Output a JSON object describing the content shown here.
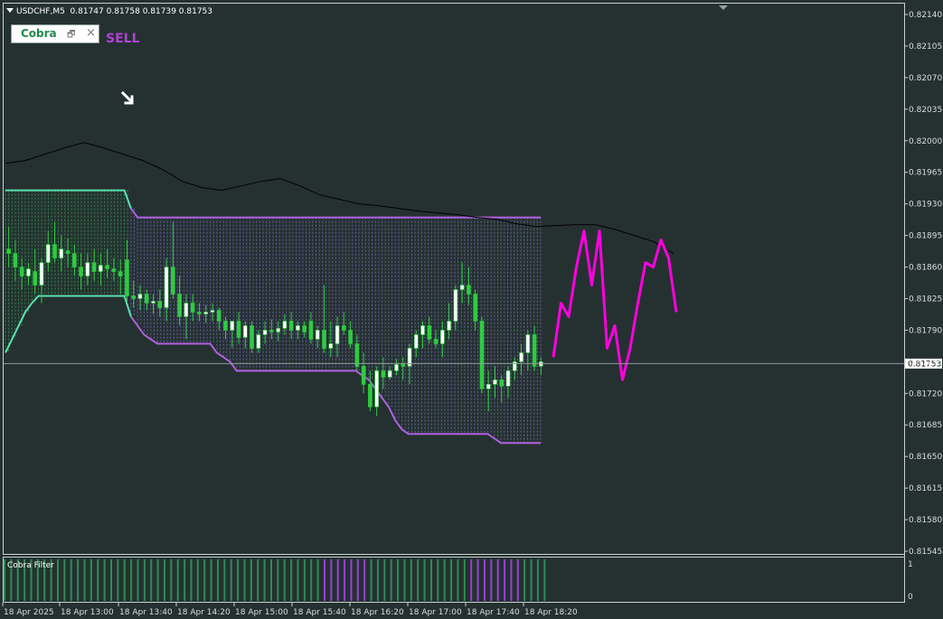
{
  "header": {
    "symbol": "USDCHF,M5",
    "ohlc": "0.81747 0.81758 0.81739 0.81753"
  },
  "indicator_box": {
    "name": "Cobra",
    "partial": "!",
    "close_glyph": "×"
  },
  "signal": {
    "text": "SELL",
    "color": "#b340d8"
  },
  "current_price": "0.81753",
  "subwindow": {
    "label": "Cobra Filter",
    "levels": [
      "1",
      "0"
    ]
  },
  "colors": {
    "background": "#253130",
    "bull_candle": "#ffffff",
    "bear_candle": "#2ecc40",
    "upper_band_green": "#5ae0b0",
    "band_purple": "#b060e0",
    "forecast": "#ff00e0",
    "filter_green": "#2e8b57",
    "filter_purple": "#9b40d8"
  },
  "chart_data": {
    "type": "candlestick",
    "title": "USDCHF,M5",
    "y_tick_labels": [
      "0.82140",
      "0.82105",
      "0.82070",
      "0.82035",
      "0.82000",
      "0.81965",
      "0.81930",
      "0.81895",
      "0.81860",
      "0.81825",
      "0.81790",
      "0.81755",
      "0.81720",
      "0.81685",
      "0.81650",
      "0.81615",
      "0.81580",
      "0.81545"
    ],
    "x_tick_labels": [
      "18 Apr 2025",
      "18 Apr 13:00",
      "18 Apr 13:40",
      "18 Apr 14:20",
      "18 Apr 15:00",
      "18 Apr 15:40",
      "18 Apr 16:20",
      "18 Apr 17:00",
      "18 Apr 17:40",
      "18 Apr 18:20"
    ],
    "ylim": [
      0.8154,
      0.82145
    ],
    "candles": [
      {
        "o": 0.8188,
        "h": 0.81905,
        "l": 0.8186,
        "c": 0.81875
      },
      {
        "o": 0.81875,
        "h": 0.8189,
        "l": 0.81845,
        "c": 0.8186
      },
      {
        "o": 0.8186,
        "h": 0.8187,
        "l": 0.81835,
        "c": 0.8185
      },
      {
        "o": 0.8185,
        "h": 0.81865,
        "l": 0.8184,
        "c": 0.81858
      },
      {
        "o": 0.81855,
        "h": 0.8188,
        "l": 0.8183,
        "c": 0.8184
      },
      {
        "o": 0.8184,
        "h": 0.8187,
        "l": 0.8182,
        "c": 0.81865
      },
      {
        "o": 0.81865,
        "h": 0.819,
        "l": 0.81855,
        "c": 0.81885
      },
      {
        "o": 0.81885,
        "h": 0.8191,
        "l": 0.81865,
        "c": 0.8187
      },
      {
        "o": 0.8187,
        "h": 0.81895,
        "l": 0.81855,
        "c": 0.8188
      },
      {
        "o": 0.81878,
        "h": 0.81892,
        "l": 0.8186,
        "c": 0.81875
      },
      {
        "o": 0.81875,
        "h": 0.81885,
        "l": 0.8185,
        "c": 0.8186
      },
      {
        "o": 0.8186,
        "h": 0.81875,
        "l": 0.81835,
        "c": 0.8185
      },
      {
        "o": 0.8185,
        "h": 0.81875,
        "l": 0.8184,
        "c": 0.81865
      },
      {
        "o": 0.81865,
        "h": 0.8188,
        "l": 0.81845,
        "c": 0.81855
      },
      {
        "o": 0.81855,
        "h": 0.81875,
        "l": 0.8184,
        "c": 0.81862
      },
      {
        "o": 0.81862,
        "h": 0.8188,
        "l": 0.81848,
        "c": 0.81858
      },
      {
        "o": 0.81858,
        "h": 0.8187,
        "l": 0.81845,
        "c": 0.81855
      },
      {
        "o": 0.81855,
        "h": 0.81868,
        "l": 0.8183,
        "c": 0.8185
      },
      {
        "o": 0.81868,
        "h": 0.8189,
        "l": 0.81822,
        "c": 0.81828
      },
      {
        "o": 0.81828,
        "h": 0.81845,
        "l": 0.81815,
        "c": 0.81825
      },
      {
        "o": 0.81825,
        "h": 0.8184,
        "l": 0.81812,
        "c": 0.8183
      },
      {
        "o": 0.8183,
        "h": 0.81835,
        "l": 0.81812,
        "c": 0.8182
      },
      {
        "o": 0.8182,
        "h": 0.8183,
        "l": 0.81808,
        "c": 0.81822
      },
      {
        "o": 0.81822,
        "h": 0.81835,
        "l": 0.81805,
        "c": 0.81815
      },
      {
        "o": 0.81815,
        "h": 0.8187,
        "l": 0.818,
        "c": 0.8186
      },
      {
        "o": 0.8186,
        "h": 0.8191,
        "l": 0.81825,
        "c": 0.8183
      },
      {
        "o": 0.8183,
        "h": 0.8185,
        "l": 0.81795,
        "c": 0.81805
      },
      {
        "o": 0.81805,
        "h": 0.8183,
        "l": 0.8178,
        "c": 0.8182
      },
      {
        "o": 0.8182,
        "h": 0.8183,
        "l": 0.818,
        "c": 0.8181
      },
      {
        "o": 0.8181,
        "h": 0.8182,
        "l": 0.818,
        "c": 0.81808
      },
      {
        "o": 0.81808,
        "h": 0.81818,
        "l": 0.81798,
        "c": 0.8181
      },
      {
        "o": 0.8181,
        "h": 0.8182,
        "l": 0.818,
        "c": 0.81812
      },
      {
        "o": 0.81812,
        "h": 0.81815,
        "l": 0.8179,
        "c": 0.818
      },
      {
        "o": 0.818,
        "h": 0.81805,
        "l": 0.8178,
        "c": 0.8179
      },
      {
        "o": 0.8179,
        "h": 0.818,
        "l": 0.8177,
        "c": 0.818
      },
      {
        "o": 0.818,
        "h": 0.8181,
        "l": 0.81775,
        "c": 0.81782
      },
      {
        "o": 0.81782,
        "h": 0.818,
        "l": 0.8177,
        "c": 0.81795
      },
      {
        "o": 0.81795,
        "h": 0.818,
        "l": 0.81765,
        "c": 0.8177
      },
      {
        "o": 0.8177,
        "h": 0.8179,
        "l": 0.81765,
        "c": 0.81785
      },
      {
        "o": 0.81785,
        "h": 0.818,
        "l": 0.81775,
        "c": 0.8179
      },
      {
        "o": 0.8179,
        "h": 0.81802,
        "l": 0.8178,
        "c": 0.81788
      },
      {
        "o": 0.81788,
        "h": 0.818,
        "l": 0.81778,
        "c": 0.81792
      },
      {
        "o": 0.81792,
        "h": 0.81808,
        "l": 0.81785,
        "c": 0.818
      },
      {
        "o": 0.818,
        "h": 0.8181,
        "l": 0.8178,
        "c": 0.8179
      },
      {
        "o": 0.8179,
        "h": 0.818,
        "l": 0.8178,
        "c": 0.81795
      },
      {
        "o": 0.81795,
        "h": 0.818,
        "l": 0.81782,
        "c": 0.81788
      },
      {
        "o": 0.818,
        "h": 0.8181,
        "l": 0.81775,
        "c": 0.8178
      },
      {
        "o": 0.8178,
        "h": 0.81795,
        "l": 0.8177,
        "c": 0.8179
      },
      {
        "o": 0.8179,
        "h": 0.8184,
        "l": 0.81765,
        "c": 0.8177
      },
      {
        "o": 0.8177,
        "h": 0.818,
        "l": 0.8176,
        "c": 0.81775
      },
      {
        "o": 0.81775,
        "h": 0.81805,
        "l": 0.8176,
        "c": 0.81795
      },
      {
        "o": 0.81795,
        "h": 0.8181,
        "l": 0.81785,
        "c": 0.8179
      },
      {
        "o": 0.8179,
        "h": 0.818,
        "l": 0.8177,
        "c": 0.81775
      },
      {
        "o": 0.81775,
        "h": 0.81785,
        "l": 0.81745,
        "c": 0.8175
      },
      {
        "o": 0.8175,
        "h": 0.81765,
        "l": 0.8172,
        "c": 0.8173
      },
      {
        "o": 0.8173,
        "h": 0.81745,
        "l": 0.817,
        "c": 0.81705
      },
      {
        "o": 0.81705,
        "h": 0.8175,
        "l": 0.81695,
        "c": 0.81745
      },
      {
        "o": 0.81745,
        "h": 0.8176,
        "l": 0.81725,
        "c": 0.81738
      },
      {
        "o": 0.81738,
        "h": 0.8175,
        "l": 0.81735,
        "c": 0.81745
      },
      {
        "o": 0.81745,
        "h": 0.81758,
        "l": 0.8174,
        "c": 0.81752
      },
      {
        "o": 0.81752,
        "h": 0.8176,
        "l": 0.81735,
        "c": 0.8175
      },
      {
        "o": 0.8175,
        "h": 0.81775,
        "l": 0.8173,
        "c": 0.8177
      },
      {
        "o": 0.8177,
        "h": 0.8179,
        "l": 0.8176,
        "c": 0.81785
      },
      {
        "o": 0.81785,
        "h": 0.818,
        "l": 0.8177,
        "c": 0.81795
      },
      {
        "o": 0.81795,
        "h": 0.81805,
        "l": 0.81775,
        "c": 0.8178
      },
      {
        "o": 0.8178,
        "h": 0.8179,
        "l": 0.8177,
        "c": 0.81775
      },
      {
        "o": 0.81775,
        "h": 0.818,
        "l": 0.8176,
        "c": 0.8179
      },
      {
        "o": 0.8179,
        "h": 0.8182,
        "l": 0.8178,
        "c": 0.818
      },
      {
        "o": 0.818,
        "h": 0.8184,
        "l": 0.8179,
        "c": 0.81835
      },
      {
        "o": 0.81835,
        "h": 0.81865,
        "l": 0.8182,
        "c": 0.8184
      },
      {
        "o": 0.8184,
        "h": 0.8186,
        "l": 0.81818,
        "c": 0.8183
      },
      {
        "o": 0.8183,
        "h": 0.81835,
        "l": 0.8179,
        "c": 0.818
      },
      {
        "o": 0.818,
        "h": 0.81805,
        "l": 0.8172,
        "c": 0.81725
      },
      {
        "o": 0.81725,
        "h": 0.81745,
        "l": 0.817,
        "c": 0.8173
      },
      {
        "o": 0.8173,
        "h": 0.8175,
        "l": 0.81715,
        "c": 0.81735
      },
      {
        "o": 0.81735,
        "h": 0.8174,
        "l": 0.8171,
        "c": 0.81728
      },
      {
        "o": 0.81728,
        "h": 0.8175,
        "l": 0.81715,
        "c": 0.81745
      },
      {
        "o": 0.81745,
        "h": 0.8176,
        "l": 0.81735,
        "c": 0.81755
      },
      {
        "o": 0.81755,
        "h": 0.81775,
        "l": 0.8174,
        "c": 0.81765
      },
      {
        "o": 0.81765,
        "h": 0.8179,
        "l": 0.81745,
        "c": 0.81785
      },
      {
        "o": 0.81785,
        "h": 0.81795,
        "l": 0.81745,
        "c": 0.8175
      },
      {
        "o": 0.8175,
        "h": 0.8176,
        "l": 0.8174,
        "c": 0.81755
      }
    ],
    "moving_average": [
      0.81975,
      0.81978,
      0.81985,
      0.81992,
      0.81998,
      0.81992,
      0.81985,
      0.81978,
      0.81968,
      0.81955,
      0.81948,
      0.81945,
      0.8195,
      0.81955,
      0.81958,
      0.8195,
      0.8194,
      0.81935,
      0.8193,
      0.81928,
      0.81925,
      0.81922,
      0.8192,
      0.81918,
      0.81915,
      0.81913,
      0.81908,
      0.81905,
      0.81906,
      0.81907,
      0.81907,
      0.81902,
      0.81895,
      0.81888,
      0.81875
    ],
    "band_upper": [
      0.81945,
      0.81945,
      0.81945,
      0.81945,
      0.81945,
      0.81945,
      0.81945,
      0.81945,
      0.81945,
      0.81945,
      0.81945,
      0.81945,
      0.81945,
      0.81945,
      0.81945,
      0.81945,
      0.81945,
      0.81945,
      0.81945,
      0.81925,
      0.81915,
      0.81915,
      0.81915,
      0.81915,
      0.81915,
      0.81915,
      0.81915,
      0.81915,
      0.81915,
      0.81915,
      0.81915,
      0.81915,
      0.81915,
      0.81915,
      0.81915,
      0.81915,
      0.81915,
      0.81915,
      0.81915,
      0.81915,
      0.81915,
      0.81915,
      0.81915,
      0.81915,
      0.81915,
      0.81915,
      0.81915,
      0.81915,
      0.81915,
      0.81915,
      0.81915,
      0.81915,
      0.81915,
      0.81915,
      0.81915,
      0.81915,
      0.81915,
      0.81915,
      0.81915,
      0.81915,
      0.81915,
      0.81915,
      0.81915,
      0.81915,
      0.81915,
      0.81915,
      0.81915,
      0.81915,
      0.81915,
      0.81915,
      0.81915,
      0.81915,
      0.81915,
      0.81915,
      0.81915,
      0.81915,
      0.81915,
      0.81915,
      0.81915,
      0.81915,
      0.81915,
      0.81915
    ],
    "band_lower": [
      0.81765,
      0.8178,
      0.81795,
      0.8181,
      0.8182,
      0.81828,
      0.81828,
      0.81828,
      0.81828,
      0.81828,
      0.81828,
      0.81828,
      0.81828,
      0.81828,
      0.81828,
      0.81828,
      0.81828,
      0.81828,
      0.81828,
      0.81805,
      0.81795,
      0.81785,
      0.8178,
      0.81775,
      0.81775,
      0.81775,
      0.81775,
      0.81775,
      0.81775,
      0.81775,
      0.81775,
      0.81775,
      0.81765,
      0.8176,
      0.81755,
      0.81745,
      0.81745,
      0.81745,
      0.81745,
      0.81745,
      0.81745,
      0.81745,
      0.81745,
      0.81745,
      0.81745,
      0.81745,
      0.81745,
      0.81745,
      0.81745,
      0.81745,
      0.81745,
      0.81745,
      0.81745,
      0.81745,
      0.8174,
      0.81735,
      0.81725,
      0.81715,
      0.81705,
      0.8169,
      0.8168,
      0.81675,
      0.81675,
      0.81675,
      0.81675,
      0.81675,
      0.81675,
      0.81675,
      0.81675,
      0.81675,
      0.81675,
      0.81675,
      0.81675,
      0.81675,
      0.8167,
      0.81665,
      0.81665,
      0.81665,
      0.81665,
      0.81665,
      0.81665,
      0.81665
    ],
    "filter_bars": [
      "g",
      "g",
      "g",
      "g",
      "g",
      "g",
      "g",
      "g",
      "g",
      "g",
      "g",
      "g",
      "g",
      "g",
      "g",
      "g",
      "g",
      "g",
      "g",
      "g",
      "g",
      "g",
      "g",
      "g",
      "g",
      "g",
      "g",
      "g",
      "g",
      "g",
      "g",
      "g",
      "g",
      "g",
      "g",
      "g",
      "g",
      "g",
      "g",
      "g",
      "g",
      "g",
      "g",
      "g",
      "g",
      "g",
      "g",
      "g",
      "g",
      "g",
      "g",
      "g",
      "g",
      "g",
      "g",
      "g",
      "g",
      "g",
      "g",
      "g",
      "g",
      "g",
      "g",
      "g",
      "g",
      "g",
      "g",
      "g",
      "g",
      "g",
      "g",
      "g",
      "g",
      "g",
      "g",
      "g",
      "g",
      "g",
      "g",
      "g",
      "g",
      "g",
      "g",
      "g",
      "g",
      "g",
      "g",
      "g",
      "g",
      "g",
      "g",
      "g",
      "g",
      "g",
      "g",
      "p",
      "p",
      "p",
      "p",
      "p",
      "p",
      "p",
      "p",
      "p",
      "p",
      "p",
      "p",
      "p",
      "p",
      "p",
      "g",
      "g",
      "g",
      "g",
      "g",
      "g",
      "g",
      "g",
      "g",
      "g",
      "g",
      "g",
      "g",
      "g",
      "g",
      "g",
      "g",
      "g",
      "g",
      "g",
      "g",
      "g",
      "g",
      "g",
      "g",
      "g",
      "g",
      "g",
      "g",
      "g",
      "p",
      "p",
      "p",
      "p",
      "p",
      "p",
      "p",
      "p",
      "p",
      "p",
      "p",
      "p",
      "p",
      "p",
      "p",
      "g",
      "g",
      "g",
      "g",
      "g",
      "g",
      "g",
      "g"
    ],
    "forecast": [
      0.8176,
      0.8182,
      0.81805,
      0.8186,
      0.819,
      0.8184,
      0.819,
      0.8177,
      0.81795,
      0.81735,
      0.8177,
      0.8182,
      0.81865,
      0.8186,
      0.8189,
      0.8187,
      0.8181
    ]
  }
}
